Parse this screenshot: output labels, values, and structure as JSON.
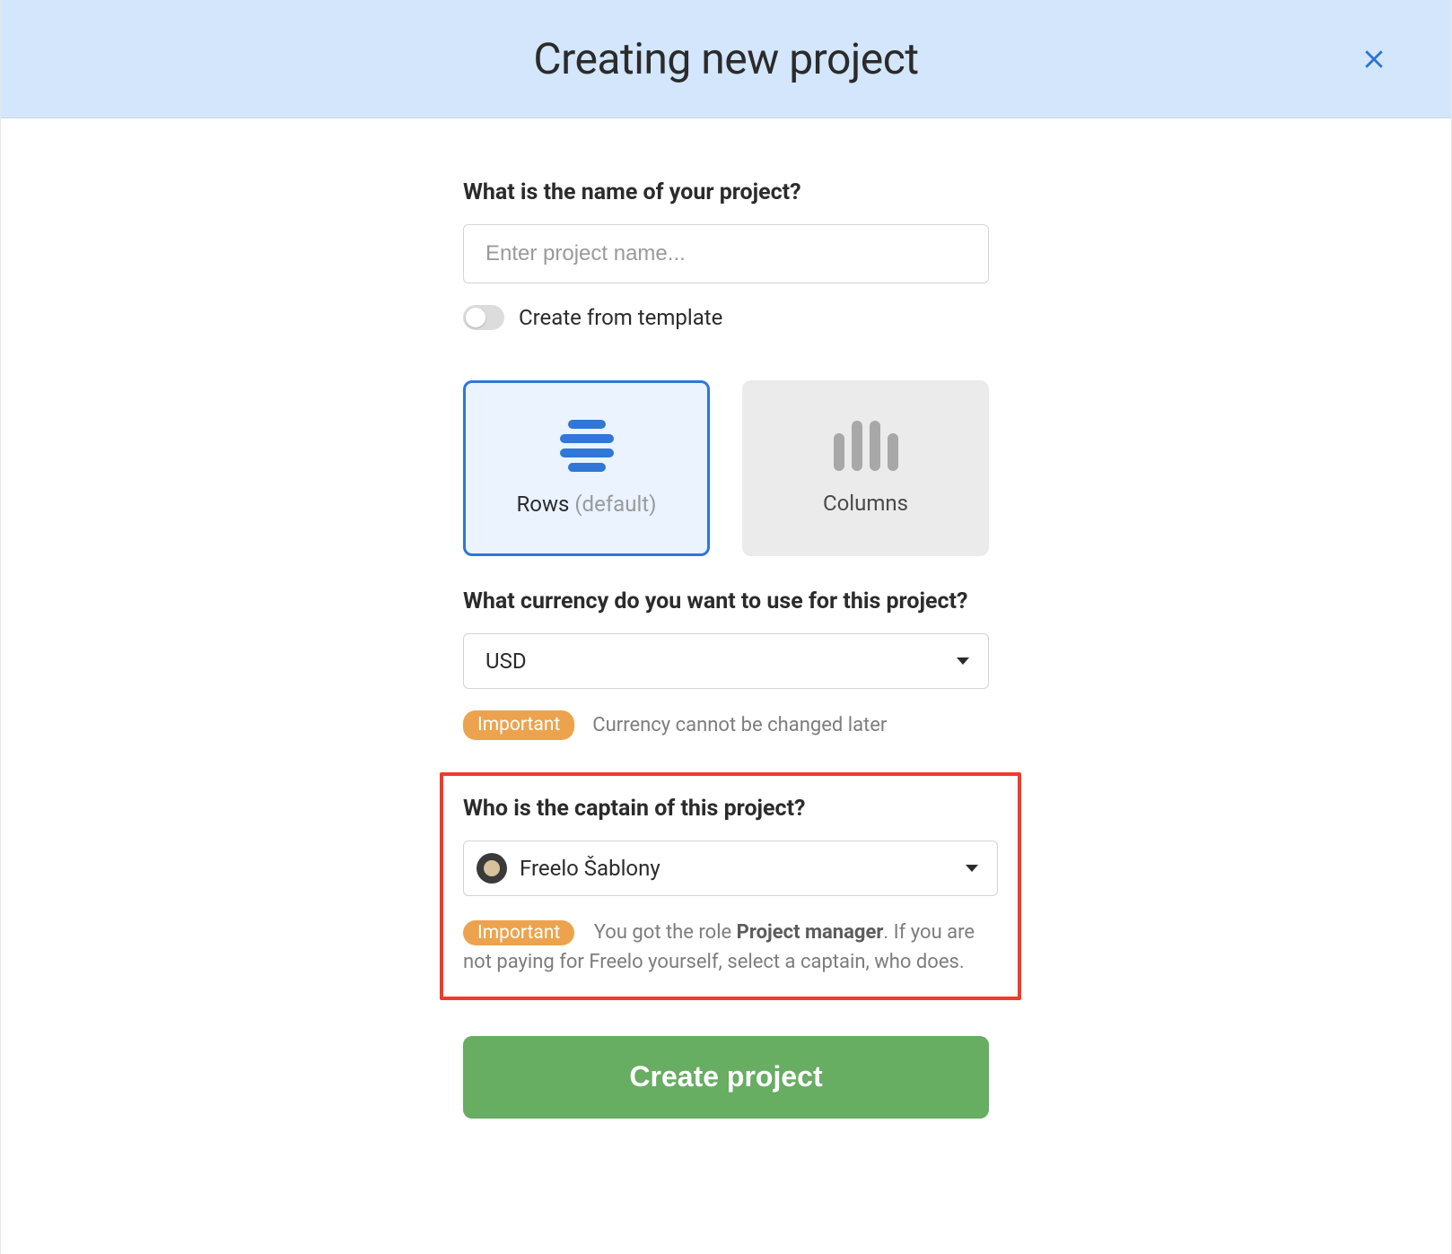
{
  "header": {
    "title": "Creating new project"
  },
  "project_name": {
    "label": "What is the name of your project?",
    "placeholder": "Enter project name...",
    "value": ""
  },
  "template_toggle": {
    "label": "Create from template",
    "enabled": false
  },
  "view_options": {
    "rows": {
      "label": "Rows",
      "suffix": "(default)",
      "selected": true
    },
    "columns": {
      "label": "Columns",
      "selected": false
    }
  },
  "currency": {
    "label": "What currency do you want to use for this project?",
    "value": "USD",
    "badge": "Important",
    "note": "Currency cannot be changed later"
  },
  "captain": {
    "label": "Who is the captain of this project?",
    "value": "Freelo Šablony",
    "badge": "Important",
    "note_prefix": "You got the role ",
    "note_role": "Project manager",
    "note_suffix": ". If you are not paying for Freelo yourself, select a captain, who does."
  },
  "submit": {
    "label": "Create project"
  }
}
